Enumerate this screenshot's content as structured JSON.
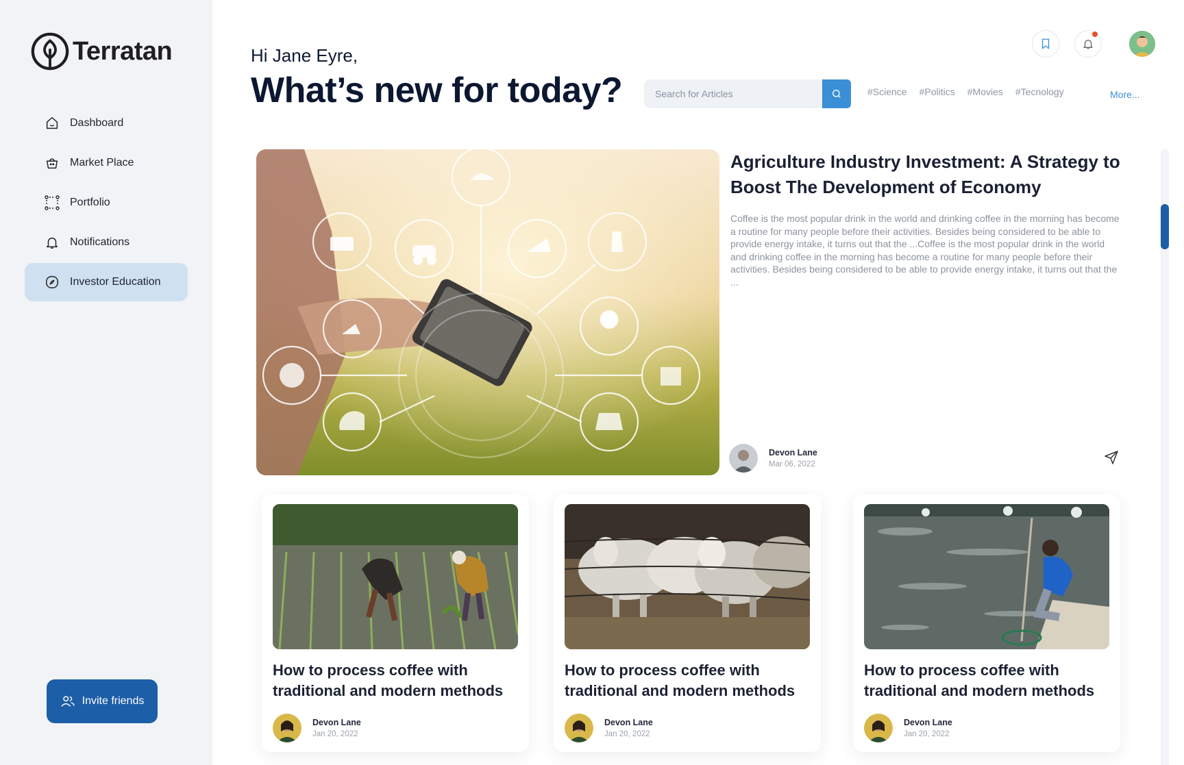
{
  "app": {
    "name": "Terratan"
  },
  "sidebar": {
    "items": [
      {
        "label": "Dashboard",
        "icon": "home-icon",
        "active": false
      },
      {
        "label": "Market Place",
        "icon": "basket-icon",
        "active": false
      },
      {
        "label": "Portfolio",
        "icon": "portfolio-icon",
        "active": false
      },
      {
        "label": "Notifications",
        "icon": "bell-icon",
        "active": false
      },
      {
        "label": "Investor Education",
        "icon": "compass-icon",
        "active": true
      }
    ],
    "invite_label": "Invite friends"
  },
  "header": {
    "greeting": "Hi Jane Eyre,",
    "headline": "What’s new for today?",
    "search_placeholder": "Search for Articles",
    "tags": [
      "#Science",
      "#Politics",
      "#Movies",
      "#Tecnology"
    ],
    "more_label": "More..."
  },
  "featured": {
    "title": "Agriculture Industry Investment: A Strategy to Boost The Development of Economy",
    "body": "Coffee is the most popular drink in the world and drinking coffee in the morning has become a routine for many people before their activities. Besides being considered to be able to provide energy intake, it turns out that the ...Coffee is the most popular drink in the world and drinking coffee in the morning has become a routine for many people before their activities. Besides being considered to be able to provide energy intake, it turns out that the ...",
    "author": "Devon Lane",
    "date": "Mar 06, 2022"
  },
  "cards": [
    {
      "title": "How to process coffee with traditional and modern methods",
      "author": "Devon Lane",
      "date": "Jan 20, 2022"
    },
    {
      "title": "How to process coffee with traditional and modern methods",
      "author": "Devon Lane",
      "date": "Jan 20, 2022"
    },
    {
      "title": "How to process coffee with traditional and modern methods",
      "author": "Devon Lane",
      "date": "Jan 20, 2022"
    }
  ],
  "colors": {
    "primary": "#1d5ea8",
    "accent": "#3a8fd6",
    "active_nav": "#cfe0f0",
    "notification_dot": "#e2522f"
  }
}
